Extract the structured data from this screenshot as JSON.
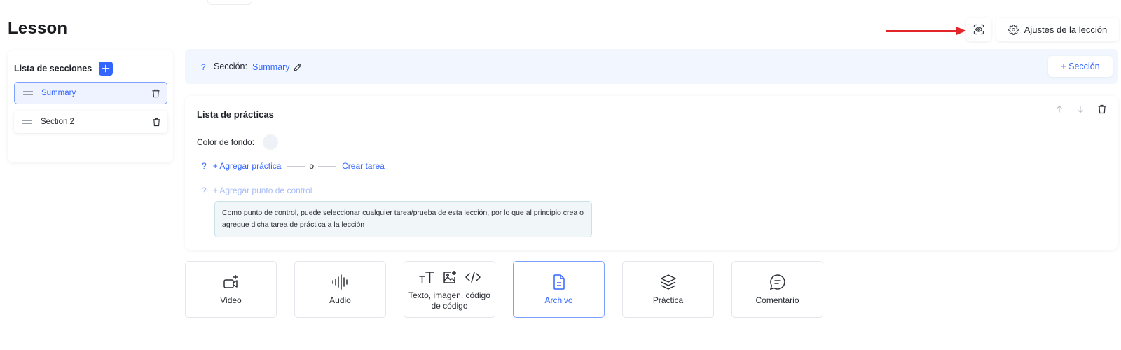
{
  "page": {
    "title": "Lesson"
  },
  "header": {
    "settings_label": "Ajustes de la lección",
    "preview_icon": "eye-scan-icon",
    "settings_icon": "gear-icon"
  },
  "sidebar": {
    "title": "Lista de secciones",
    "items": [
      {
        "label": "Summary",
        "active": true
      },
      {
        "label": "Section 2",
        "active": false
      }
    ]
  },
  "section_bar": {
    "help": "?",
    "label": "Sección:",
    "name": "Summary",
    "add_label": "+ Sección"
  },
  "practice": {
    "title": "Lista de prácticas",
    "bg_label": "Color de fondo:",
    "help": "?",
    "add_practice": "+ Agregar práctica",
    "or": "o",
    "create_task": "Crear tarea",
    "add_checkpoint": "+ Agregar punto de control",
    "info": "Como punto de control, puede seleccionar cualquier tarea/prueba de esta lección, por lo que al principio crea o agregue dicha tarea de práctica a la lección"
  },
  "tiles": [
    {
      "label": "Video",
      "icon": "video-add-icon"
    },
    {
      "label": "Audio",
      "icon": "audio-wave-icon"
    },
    {
      "label": "Texto, imagen, código de código",
      "icon": "text-image-code-icon"
    },
    {
      "label": "Archivo",
      "icon": "file-icon",
      "selected": true
    },
    {
      "label": "Práctica",
      "icon": "layers-icon"
    },
    {
      "label": "Comentario",
      "icon": "comment-icon"
    }
  ],
  "colors": {
    "accent": "#3366ff",
    "annotation_arrow": "#e3262a",
    "section_bar_bg": "#f1f6ff"
  }
}
